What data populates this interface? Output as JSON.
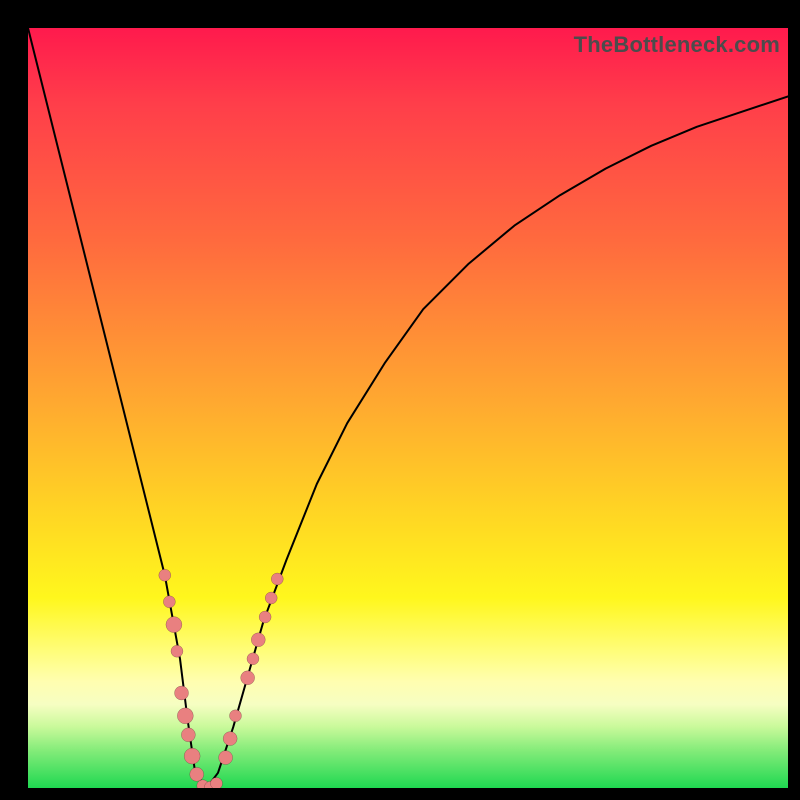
{
  "watermark": "TheBottleneck.com",
  "chart_data": {
    "type": "line",
    "title": "",
    "xlabel": "",
    "ylabel": "",
    "xlim": [
      0,
      100
    ],
    "ylim": [
      0,
      100
    ],
    "grid": false,
    "legend": false,
    "series": [
      {
        "name": "bottleneck-curve",
        "x": [
          0,
          2,
          4,
          6,
          8,
          10,
          12,
          14,
          16,
          18,
          20,
          21,
          22,
          23.5,
          25,
          27,
          29,
          31,
          34,
          38,
          42,
          47,
          52,
          58,
          64,
          70,
          76,
          82,
          88,
          94,
          100
        ],
        "y": [
          100,
          92,
          84,
          76,
          68,
          60,
          52,
          44,
          36,
          28,
          17,
          9,
          2,
          0,
          2,
          8,
          15,
          22,
          30,
          40,
          48,
          56,
          63,
          69,
          74,
          78,
          81.5,
          84.5,
          87,
          89,
          91
        ]
      }
    ],
    "markers": [
      {
        "series": "bottleneck-curve",
        "x": 18.0,
        "y": 28.0,
        "r": 6
      },
      {
        "series": "bottleneck-curve",
        "x": 18.6,
        "y": 24.5,
        "r": 6
      },
      {
        "series": "bottleneck-curve",
        "x": 19.2,
        "y": 21.5,
        "r": 8
      },
      {
        "series": "bottleneck-curve",
        "x": 19.6,
        "y": 18.0,
        "r": 6
      },
      {
        "series": "bottleneck-curve",
        "x": 20.2,
        "y": 12.5,
        "r": 7
      },
      {
        "series": "bottleneck-curve",
        "x": 20.7,
        "y": 9.5,
        "r": 8
      },
      {
        "series": "bottleneck-curve",
        "x": 21.1,
        "y": 7.0,
        "r": 7
      },
      {
        "series": "bottleneck-curve",
        "x": 21.6,
        "y": 4.2,
        "r": 8
      },
      {
        "series": "bottleneck-curve",
        "x": 22.2,
        "y": 1.8,
        "r": 7
      },
      {
        "series": "bottleneck-curve",
        "x": 23.0,
        "y": 0.3,
        "r": 6
      },
      {
        "series": "bottleneck-curve",
        "x": 24.0,
        "y": 0.1,
        "r": 6
      },
      {
        "series": "bottleneck-curve",
        "x": 24.8,
        "y": 0.6,
        "r": 6
      },
      {
        "series": "bottleneck-curve",
        "x": 26.0,
        "y": 4.0,
        "r": 7
      },
      {
        "series": "bottleneck-curve",
        "x": 26.6,
        "y": 6.5,
        "r": 7
      },
      {
        "series": "bottleneck-curve",
        "x": 27.3,
        "y": 9.5,
        "r": 6
      },
      {
        "series": "bottleneck-curve",
        "x": 28.9,
        "y": 14.5,
        "r": 7
      },
      {
        "series": "bottleneck-curve",
        "x": 29.6,
        "y": 17.0,
        "r": 6
      },
      {
        "series": "bottleneck-curve",
        "x": 30.3,
        "y": 19.5,
        "r": 7
      },
      {
        "series": "bottleneck-curve",
        "x": 31.2,
        "y": 22.5,
        "r": 6
      },
      {
        "series": "bottleneck-curve",
        "x": 32.0,
        "y": 25.0,
        "r": 6
      },
      {
        "series": "bottleneck-curve",
        "x": 32.8,
        "y": 27.5,
        "r": 6
      }
    ],
    "colors": {
      "gradient_top": "#ff1a4d",
      "gradient_mid": "#fff71d",
      "gradient_bottom": "#1fd851",
      "curve": "#000000",
      "marker": "#e98080",
      "frame": "#000000"
    }
  }
}
